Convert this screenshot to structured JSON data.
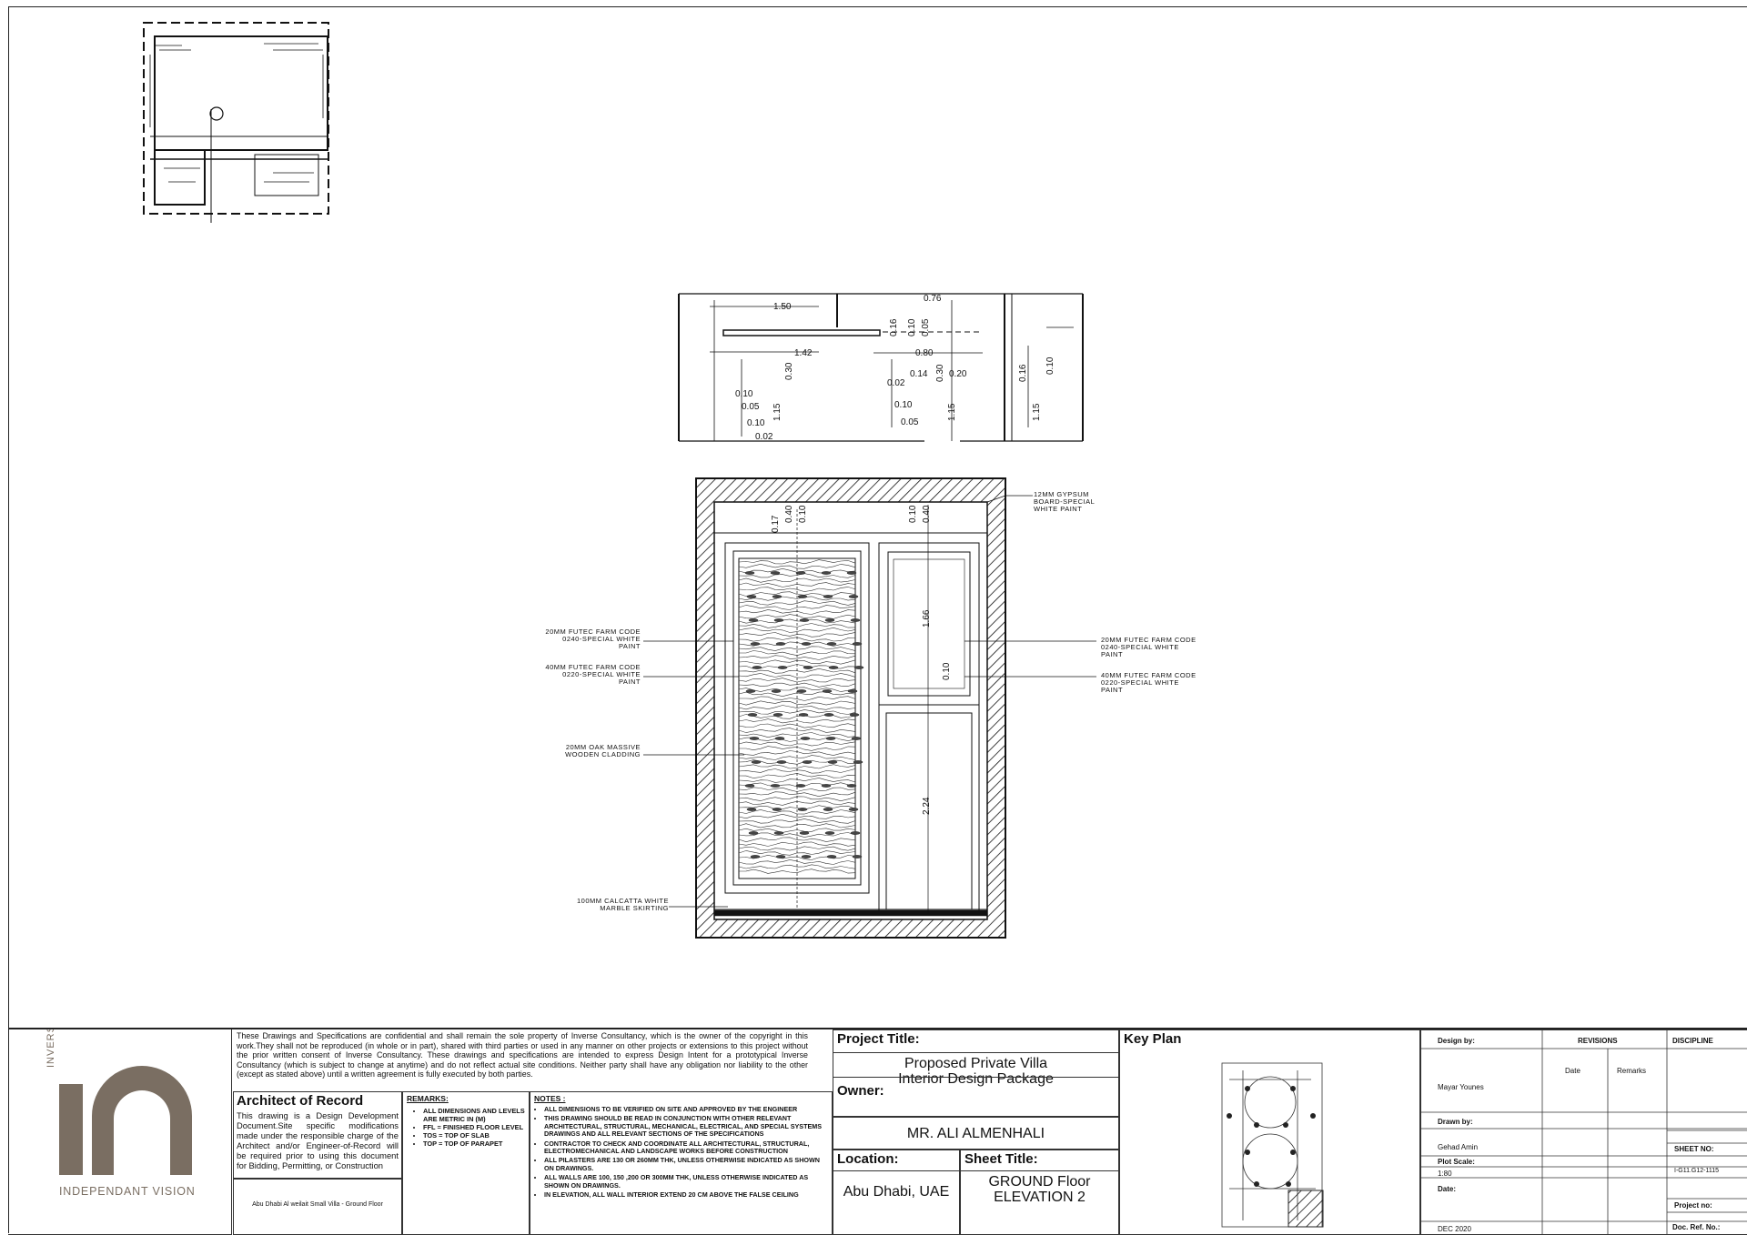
{
  "callouts": {
    "ceiling": [
      "12MM GYPSUM",
      "BOARD-SPECIAL",
      "WHITE PAINT"
    ],
    "left_1": [
      "20MM FUTEC FARM CODE",
      "0240-SPECIAL WHITE",
      "PAINT"
    ],
    "left_2": [
      "40MM FUTEC FARM CODE",
      "0220-SPECIAL WHITE",
      "PAINT"
    ],
    "left_3": [
      "20MM OAK MASSIVE",
      "WOODEN CLADDING"
    ],
    "left_4": [
      "100MM CALCATTA WHITE",
      "MARBLE SKIRTING"
    ],
    "right_1": [
      "20MM FUTEC FARM CODE",
      "0240-SPECIAL WHITE",
      "PAINT"
    ],
    "right_2": [
      "40MM FUTEC FARM CODE",
      "0220-SPECIAL WHITE",
      "PAINT"
    ]
  },
  "elevation_dims": {
    "d1": "0.17",
    "d2": "0.40",
    "d3": "0.10",
    "d4": "0.10",
    "d5": "0.40",
    "d6": "1.66",
    "d7": "0.10",
    "d8": "2.24"
  },
  "plan_dims": {
    "p1": "1.50",
    "p2": "0.76",
    "p3": "1.42",
    "p4": "0.80",
    "p5": "0.14",
    "p6": "0.20",
    "p7": "0.02",
    "p8": "0.10",
    "p9": "0.05",
    "p10": "0.10",
    "p11": "0.05",
    "p12": "0.10",
    "p13": "0.02",
    "p14": "0.30",
    "p15": "1.15",
    "p16": "1.15",
    "p17": "1.15",
    "p18": "0.16",
    "p19": "0.10",
    "p20": "0.05",
    "p21": "0.30",
    "p22": "0.16",
    "p23": "0.10"
  },
  "title_block": {
    "logo_vertical": "INVERSE INTERIORS",
    "logo_tagline": "INDEPENDANT VISION",
    "confidential": "These Drawings and Specifications are confidential and shall remain the sole property of Inverse Consultancy, which is the owner of the copyright in this work.They shall not be reproduced (in whole or in part), shared with third parties or used in any manner on other projects or extensions to this project without the prior written consent of Inverse Consultancy. These drawings and specifications are intended to express Design Intent for a prototypical Inverse Consultancy (which is subject to change at anytime) and do not reflect actual site conditions. Neither party shall have any obligation nor liability to the other (except as stated above) until a written agreement is fully executed by both parties.",
    "aor_title": "Architect of Record",
    "aor_text": "This drawing is a Design Development Document.Site specific modifications made under the responsible charge of the Architect and/or Engineer-of-Record will be required prior to using this document for Bidding, Permitting, or Construction",
    "remarks_title": "REMARKS:",
    "remarks": [
      "ALL DIMENSIONS AND LEVELS ARE METRIC IN (M)",
      "FFL = FINISHED FLOOR LEVEL",
      "TOS = TOP OF SLAB",
      "TOP = TOP OF PARAPET"
    ],
    "notes_title": "NOTES :",
    "notes": [
      "ALL DIMENSIONS TO BE VERIFIED ON SITE AND APPROVED BY THE ENGINEER",
      "THIS DRAWING SHOULD BE READ IN CONJUNCTION WITH OTHER RELEVANT ARCHITECTURAL, STRUCTURAL, MECHANICAL, ELECTRICAL, AND SPECIAL SYSTEMS DRAWINGS AND ALL RELEVANT SECTIONS OF THE SPECIFICATIONS",
      "CONTRACTOR TO CHECK AND COORDINATE ALL ARCHITECTURAL, STRUCTURAL, ELECTROMECHANICAL AND LANDSCAPE WORKS BEFORE CONSTRUCTION",
      "ALL PILASTERS ARE 130 OR 260MM THK, UNLESS OTHERWISE INDICATED AS SHOWN ON DRAWINGS.",
      "ALL WALLS ARE 100, 150 ,200 OR 300MM THK, UNLESS OTHERWISE INDICATED AS SHOWN ON DRAWINGS.",
      "IN ELEVATION, ALL WALL INTERIOR EXTEND 20 CM ABOVE THE FALSE CEILING"
    ],
    "file_path": "Abu Dhabi Al weilait Small Villa - Ground Floor",
    "project_title_label": "Project Title:",
    "project_title": "Proposed Private Villa",
    "project_subtitle": "Interior Design Package",
    "owner_label": "Owner:",
    "owner": "MR. ALI ALMENHALI",
    "location_label": "Location:",
    "location": "Abu Dhabi, UAE",
    "sheet_title_label": "Sheet Title:",
    "sheet_title_1": "GROUND Floor",
    "sheet_title_2": "ELEVATION 2",
    "key_plan_label": "Key Plan",
    "design_by_label": "Design by:",
    "design_by": "Mayar Younes",
    "revisions_label": "REVISIONS",
    "date_col": "Date",
    "remarks_col": "Remarks",
    "discipline_label": "DISCIPLINE",
    "drawn_by_label": "Drawn by:",
    "drawn_by": "Gehad Amin",
    "sheet_no_label": "SHEET NO:",
    "sheet_no": "I-G11.G12-1115",
    "plot_scale_label": "Plot Scale:",
    "plot_scale": "1:80",
    "date_label": "Date:",
    "project_no_label": "Project no:",
    "date": "DEC 2020",
    "doc_ref_label": "Doc. Ref. No.:"
  }
}
